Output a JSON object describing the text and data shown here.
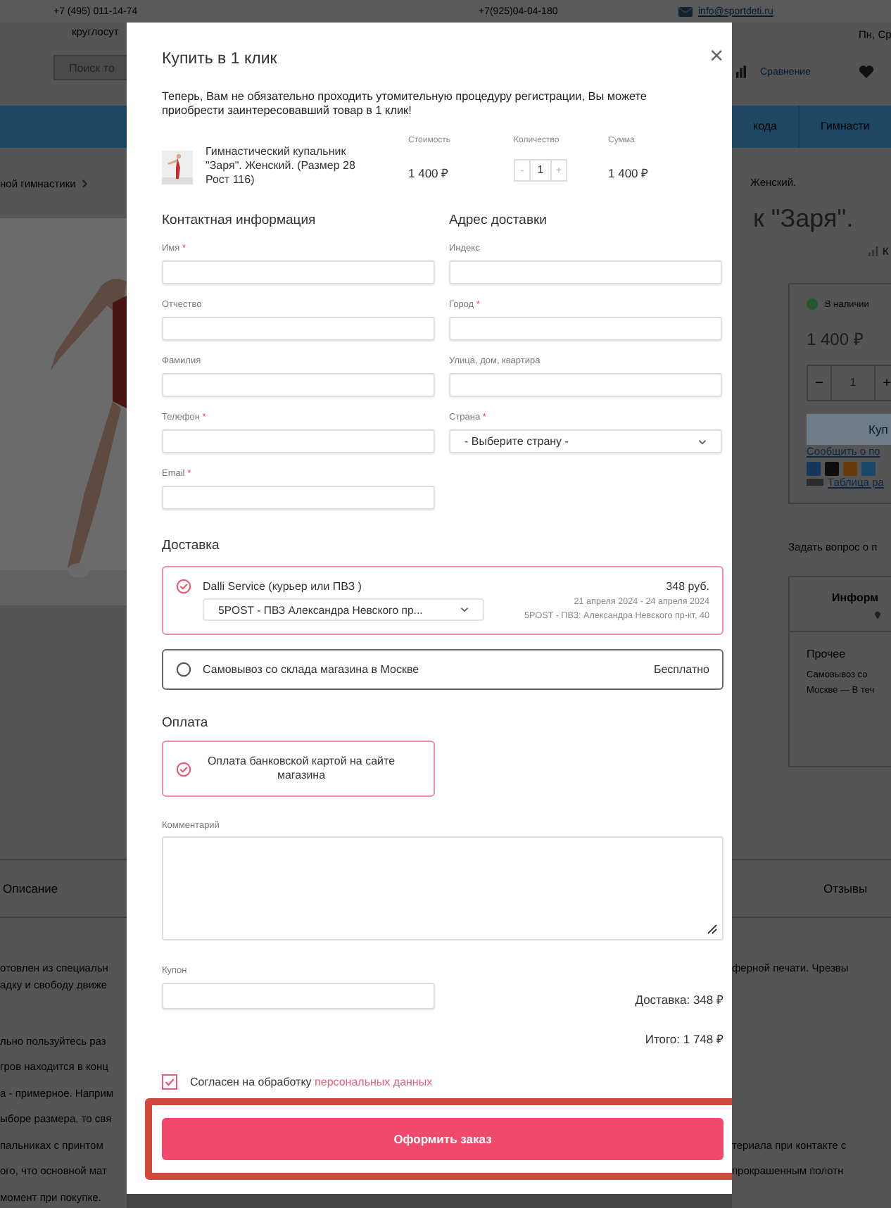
{
  "header": {
    "phone_1": "+7 (495) 011-14-74",
    "phone_2": "+7(925)04-04-180",
    "email": "info@sportdeti.ru"
  },
  "left": {
    "hours": "круглосут",
    "search_placeholder": "Поиск то",
    "breadcrumb": "ной гимнастики",
    "tab": "Описание"
  },
  "right": {
    "schedule": "Пн, Ср",
    "compare": "Сравнение",
    "nav_items": [
      "кода",
      "Гимнасти"
    ],
    "breadcrumb": "Женский.",
    "title": "к \"Заря\".",
    "rating_label": "К",
    "stock": "В наличии",
    "price": "1 400 ₽",
    "qty_minus": "−",
    "qty": "1",
    "qty_plus": "+",
    "buy": "Куп",
    "notify_link": "Сообщить о по",
    "size_link": "Таблица ра",
    "ask": "Задать вопрос о п",
    "info_heading": "Информ",
    "other_heading": "Прочее",
    "pickup_lines": [
      "Самовывоз со",
      "Москве — В теч"
    ],
    "tab": "Отзывы"
  },
  "description": [
    {
      "lines": [
        {
          "left": "отовлен из специальн",
          "right": "ферной печати. Чрезвы"
        },
        {
          "left": "адку и свободу движе"
        }
      ]
    },
    {
      "lines": [
        {
          "left": "льно пользуйтесь раз"
        },
        {
          "left": "гров находится в конц"
        },
        {
          "left": "а - примерное. Наприм"
        },
        {
          "left": "ыборе размера, то свя"
        },
        {
          "left": "пальниках с принтом",
          "right": "териала при контакте с"
        },
        {
          "left": "ого, что основной мат",
          "right": "прокрашенным полотн"
        },
        {
          "left": "момент при покупке."
        }
      ]
    }
  ],
  "modal": {
    "title": "Купить в 1 клик",
    "close": "×",
    "intro": "Теперь, Вам не обязательно проходить утомительную процедуру регистрации, Вы можете приобрести заинтересовавший товар в 1 клик!",
    "product": {
      "name": "Гимнастический купальник \"Заря\". Женский. (Размер 28 Рост 116)",
      "price_label": "Стоимость",
      "price": "1 400 ₽",
      "qty_label": "Количество",
      "minus": "-",
      "qty": "1",
      "plus": "+",
      "sum_label": "Сумма",
      "sum": "1 400 ₽"
    },
    "required_mark": "*",
    "contact": {
      "heading": "Контактная информация",
      "fields": [
        {
          "label": "Имя",
          "required": true,
          "kind": "input"
        },
        {
          "label": "Отчество",
          "required": false,
          "kind": "input"
        },
        {
          "label": "Фамилия",
          "required": false,
          "kind": "input"
        },
        {
          "label": "Телефон",
          "required": true,
          "kind": "input"
        },
        {
          "label": "Email",
          "required": true,
          "kind": "input"
        }
      ]
    },
    "address": {
      "heading": "Адрес доставки",
      "fields": [
        {
          "label": "Индекс",
          "required": false,
          "kind": "input"
        },
        {
          "label": "Город",
          "required": true,
          "kind": "input"
        },
        {
          "label": "Улица, дом, квартира",
          "required": false,
          "kind": "input"
        },
        {
          "label": "Страна",
          "required": true,
          "kind": "select",
          "value": "- Выберите страну -"
        }
      ]
    },
    "delivery": {
      "heading": "Доставка",
      "options": [
        {
          "selected": true,
          "name": "Dalli Service (курьер или ПВЗ )",
          "price": "348 руб.",
          "point": "5POST - ПВЗ Александра Невского пр...",
          "dates": "21 апреля 2024 - 24 апреля 2024",
          "address": "5POST - ПВЗ: Александра Невского пр-кт, 40"
        },
        {
          "selected": false,
          "name": "Самовывоз со склада магазина в Москве",
          "price": "Бесплатно"
        }
      ]
    },
    "payment": {
      "heading": "Оплата",
      "options": [
        {
          "selected": true,
          "name": "Оплата банковской картой на сайте магазина"
        }
      ]
    },
    "comment_label": "Комментарий",
    "coupon_label": "Купон",
    "delivery_total": "Доставка: 348 ₽",
    "total": "Итого: 1 748 ₽",
    "consent": {
      "checked": true,
      "text": "Согласен на обработку",
      "link": "персональных данных"
    },
    "submit": "Оформить заказ"
  }
}
